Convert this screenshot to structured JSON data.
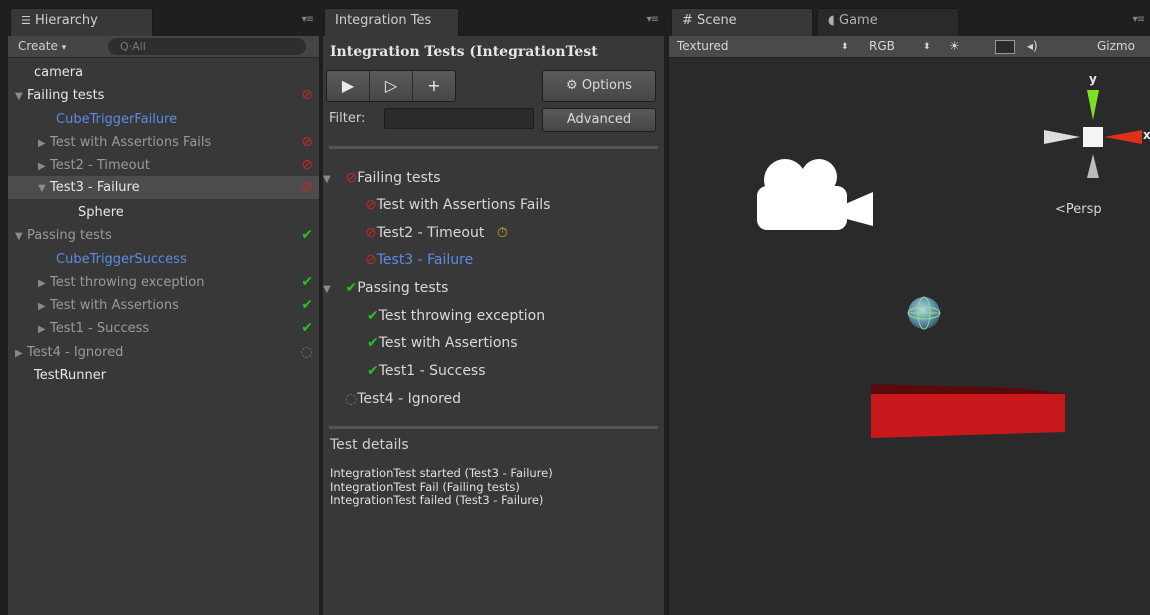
{
  "hierarchy": {
    "tab_label": "Hierarchy",
    "create_label": "Create",
    "search_placeholder": "Q·All",
    "items": [
      {
        "label": "camera"
      },
      {
        "label": "Failing tests"
      },
      {
        "label": "CubeTriggerFailure"
      },
      {
        "label": "Test with Assertions Fails"
      },
      {
        "label": "Test2 - Timeout"
      },
      {
        "label": "Test3 - Failure"
      },
      {
        "label": "Sphere"
      },
      {
        "label": "Passing tests"
      },
      {
        "label": "CubeTriggerSuccess"
      },
      {
        "label": "Test throwing exception"
      },
      {
        "label": "Test with Assertions"
      },
      {
        "label": "Test1 - Success"
      },
      {
        "label": "Test4 - Ignored"
      },
      {
        "label": "TestRunner"
      }
    ]
  },
  "tests": {
    "tab_label": "Integration Tes",
    "title": "Integration Tests (IntegrationTest",
    "options_label": "Options",
    "filter_label": "Filter:",
    "advanced_label": "Advanced",
    "tree": [
      {
        "label": "Failing tests"
      },
      {
        "label": "Test with Assertions Fails"
      },
      {
        "label": "Test2 - Timeout"
      },
      {
        "label": "Test3 - Failure"
      },
      {
        "label": "Passing tests"
      },
      {
        "label": "Test throwing exception"
      },
      {
        "label": "Test with Assertions"
      },
      {
        "label": "Test1 - Success"
      },
      {
        "label": "Test4 - Ignored"
      }
    ],
    "details_title": "Test details",
    "details_lines": [
      "IntegrationTest started (Test3 - Failure)",
      "IntegrationTest Fail (Failing tests)",
      "IntegrationTest failed (Test3 - Failure)"
    ]
  },
  "scene": {
    "tab_scene": "Scene",
    "tab_game": "Game",
    "shading": "Textured",
    "color_mode": "RGB",
    "gizmos": "Gizmo",
    "persp": "Persp",
    "axis_x": "x",
    "axis_y": "y"
  },
  "colors": {
    "fail": "#c0282a",
    "pass": "#22c422",
    "selected_blue": "#5a8ce6",
    "floor_red": "#c8181c"
  }
}
